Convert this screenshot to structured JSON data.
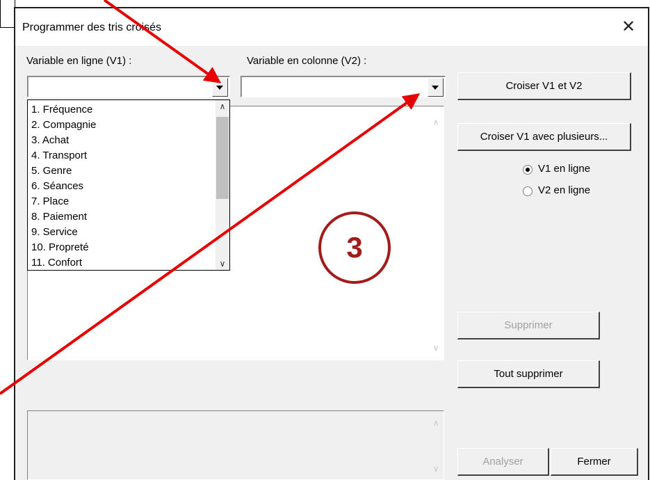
{
  "dialog": {
    "title": "Programmer des tris croisés",
    "close_glyph": "✕"
  },
  "v1": {
    "label": "Variable en ligne (V1) :",
    "value": ""
  },
  "v2": {
    "label": "Variable en colonne (V2) :",
    "value": ""
  },
  "dropdown": {
    "items": [
      "1. Fréquence",
      "2. Compagnie",
      "3. Achat",
      "4. Transport",
      "5. Genre",
      "6. Séances",
      "7. Place",
      "8. Paiement",
      "9. Service",
      "10. Propreté",
      "11. Confort"
    ]
  },
  "buttons": {
    "cross_v1_v2": "Croiser V1 et V2",
    "cross_v1_multi": "Croiser V1 avec plusieurs...",
    "delete": "Supprimer",
    "delete_all": "Tout supprimer",
    "analyze": "Analyser",
    "close": "Fermer"
  },
  "radios": {
    "v1_in_row": "V1 en ligne",
    "v2_in_row": "V2 en ligne",
    "selected": "v1_in_row"
  },
  "annotation": {
    "step_number": "3",
    "color": "#a31b1b",
    "arrow_color": "#e60000"
  }
}
